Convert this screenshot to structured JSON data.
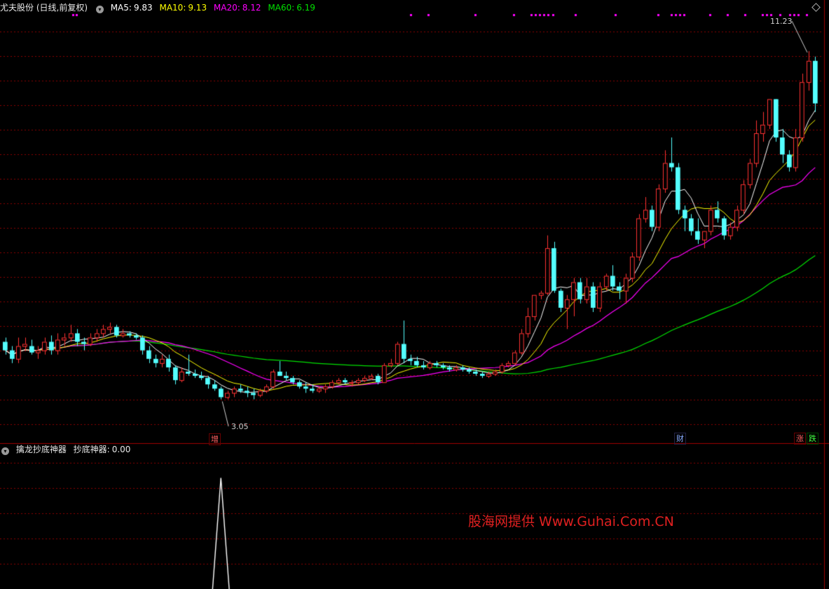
{
  "header": {
    "stock_name": "尤夫股份",
    "mode": "(日线,前复权)",
    "ma5": {
      "label": "MA5:",
      "value": "9.83",
      "color": "#ffffff"
    },
    "ma10": {
      "label": "MA10:",
      "value": "9.13",
      "color": "#ffff00"
    },
    "ma20": {
      "label": "MA20:",
      "value": "8.12",
      "color": "#ff00ff"
    },
    "ma60": {
      "label": "MA60:",
      "value": "6.19",
      "color": "#00e000"
    }
  },
  "indicator": {
    "name": "擒龙抄底神器",
    "series_label": "抄底神器:",
    "value": "0.00"
  },
  "markers": {
    "zeng": "增",
    "cai": "财",
    "zhang": "涨",
    "die": "跌"
  },
  "annotations": {
    "high_label": "11.23",
    "low_label": "3.05"
  },
  "watermark": "股海网提供 Www.Guhai.Com.CN",
  "colors": {
    "up": "#ff3232",
    "down": "#54ffff",
    "ma5": "#ffffff",
    "ma10": "#ffff00",
    "ma20": "#ff00ff",
    "ma60": "#00e000",
    "grid": "#8b0000",
    "signal_dots": "#ff00ff"
  },
  "chart_data": {
    "type": "candlestick",
    "ylim": [
      2.3,
      12.1
    ],
    "indicator_ylim": [
      0,
      1.2
    ],
    "candles": [
      [
        4.4,
        4.5,
        4.1,
        4.2
      ],
      [
        4.2,
        4.3,
        3.9,
        4.0
      ],
      [
        4.0,
        4.5,
        3.9,
        4.3
      ],
      [
        4.3,
        4.5,
        4.2,
        4.35
      ],
      [
        4.3,
        4.45,
        4.1,
        4.15
      ],
      [
        4.15,
        4.3,
        4.0,
        4.2
      ],
      [
        4.2,
        4.5,
        4.1,
        4.4
      ],
      [
        4.4,
        4.55,
        4.1,
        4.2
      ],
      [
        4.2,
        4.6,
        4.1,
        4.45
      ],
      [
        4.45,
        4.6,
        4.3,
        4.5
      ],
      [
        4.5,
        4.8,
        4.4,
        4.6
      ],
      [
        4.6,
        4.7,
        4.3,
        4.4
      ],
      [
        4.4,
        4.5,
        4.2,
        4.35
      ],
      [
        4.35,
        4.6,
        4.3,
        4.5
      ],
      [
        4.5,
        4.7,
        4.4,
        4.6
      ],
      [
        4.6,
        4.8,
        4.5,
        4.7
      ],
      [
        4.7,
        4.85,
        4.6,
        4.75
      ],
      [
        4.75,
        4.8,
        4.5,
        4.55
      ],
      [
        4.55,
        4.7,
        4.5,
        4.6
      ],
      [
        4.6,
        4.65,
        4.5,
        4.55
      ],
      [
        4.55,
        4.6,
        4.45,
        4.5
      ],
      [
        4.5,
        4.55,
        4.1,
        4.2
      ],
      [
        4.2,
        4.3,
        3.9,
        4.0
      ],
      [
        4.0,
        4.1,
        3.8,
        3.9
      ],
      [
        3.9,
        4.1,
        3.8,
        4.0
      ],
      [
        4.0,
        4.1,
        3.7,
        3.8
      ],
      [
        3.8,
        3.85,
        3.4,
        3.5
      ],
      [
        3.5,
        3.8,
        3.45,
        3.7
      ],
      [
        3.7,
        4.1,
        3.6,
        3.65
      ],
      [
        3.65,
        3.75,
        3.55,
        3.6
      ],
      [
        3.6,
        3.7,
        3.5,
        3.55
      ],
      [
        3.55,
        3.6,
        3.3,
        3.4
      ],
      [
        3.4,
        3.5,
        3.25,
        3.3
      ],
      [
        3.3,
        3.35,
        3.05,
        3.1
      ],
      [
        3.1,
        3.25,
        3.05,
        3.2
      ],
      [
        3.2,
        3.35,
        3.1,
        3.3
      ],
      [
        3.3,
        3.4,
        3.2,
        3.25
      ],
      [
        3.25,
        3.35,
        3.1,
        3.2
      ],
      [
        3.2,
        3.3,
        3.05,
        3.15
      ],
      [
        3.15,
        3.3,
        3.1,
        3.25
      ],
      [
        3.25,
        3.4,
        3.2,
        3.35
      ],
      [
        3.35,
        3.75,
        3.3,
        3.7
      ],
      [
        3.7,
        3.95,
        3.6,
        3.6
      ],
      [
        3.6,
        3.7,
        3.5,
        3.55
      ],
      [
        3.55,
        3.6,
        3.4,
        3.45
      ],
      [
        3.45,
        3.5,
        3.3,
        3.35
      ],
      [
        3.35,
        3.45,
        3.2,
        3.3
      ],
      [
        3.3,
        3.4,
        3.2,
        3.25
      ],
      [
        3.25,
        3.35,
        3.2,
        3.3
      ],
      [
        3.3,
        3.4,
        3.2,
        3.35
      ],
      [
        3.35,
        3.5,
        3.3,
        3.45
      ],
      [
        3.45,
        3.55,
        3.4,
        3.5
      ],
      [
        3.5,
        3.55,
        3.4,
        3.45
      ],
      [
        3.45,
        3.5,
        3.35,
        3.45
      ],
      [
        3.45,
        3.55,
        3.4,
        3.5
      ],
      [
        3.5,
        3.6,
        3.45,
        3.55
      ],
      [
        3.55,
        3.65,
        3.5,
        3.6
      ],
      [
        3.6,
        3.65,
        3.4,
        3.45
      ],
      [
        3.45,
        3.9,
        3.45,
        3.85
      ],
      [
        3.85,
        4.0,
        3.8,
        3.9
      ],
      [
        3.9,
        4.4,
        3.85,
        4.35
      ],
      [
        4.35,
        4.9,
        3.9,
        4.0
      ],
      [
        4.0,
        4.1,
        3.85,
        3.95
      ],
      [
        3.95,
        4.05,
        3.8,
        3.85
      ],
      [
        3.85,
        3.95,
        3.75,
        3.8
      ],
      [
        3.8,
        3.95,
        3.75,
        3.9
      ],
      [
        3.9,
        3.95,
        3.8,
        3.85
      ],
      [
        3.85,
        3.9,
        3.75,
        3.8
      ],
      [
        3.8,
        3.85,
        3.7,
        3.75
      ],
      [
        3.75,
        3.85,
        3.7,
        3.8
      ],
      [
        3.8,
        3.85,
        3.7,
        3.75
      ],
      [
        3.75,
        3.8,
        3.65,
        3.7
      ],
      [
        3.7,
        3.75,
        3.6,
        3.65
      ],
      [
        3.65,
        3.7,
        3.55,
        3.6
      ],
      [
        3.6,
        3.7,
        3.55,
        3.65
      ],
      [
        3.65,
        3.75,
        3.6,
        3.7
      ],
      [
        3.7,
        3.9,
        3.65,
        3.85
      ],
      [
        3.85,
        3.95,
        3.8,
        3.9
      ],
      [
        3.9,
        4.2,
        3.85,
        4.15
      ],
      [
        4.15,
        4.7,
        4.1,
        4.6
      ],
      [
        4.6,
        5.2,
        4.5,
        5.0
      ],
      [
        5.0,
        5.5,
        4.9,
        5.5
      ],
      [
        5.5,
        5.6,
        5.4,
        5.55
      ],
      [
        5.55,
        6.9,
        5.5,
        6.6
      ],
      [
        6.6,
        6.75,
        5.55,
        5.6
      ],
      [
        5.6,
        5.65,
        5.1,
        5.2
      ],
      [
        5.2,
        5.5,
        4.7,
        5.4
      ],
      [
        5.4,
        5.9,
        5.0,
        5.8
      ],
      [
        5.8,
        5.9,
        5.3,
        5.4
      ],
      [
        5.4,
        5.9,
        5.3,
        5.7
      ],
      [
        5.7,
        5.8,
        5.1,
        5.2
      ],
      [
        5.2,
        5.8,
        5.1,
        5.7
      ],
      [
        5.7,
        6.0,
        5.6,
        5.95
      ],
      [
        5.95,
        6.2,
        5.6,
        5.7
      ],
      [
        5.7,
        5.8,
        5.4,
        5.6
      ],
      [
        5.6,
        6.0,
        5.3,
        5.9
      ],
      [
        5.9,
        6.5,
        5.8,
        6.4
      ],
      [
        6.4,
        7.4,
        6.3,
        7.3
      ],
      [
        7.3,
        7.8,
        7.2,
        7.5
      ],
      [
        7.5,
        7.6,
        7.0,
        7.1
      ],
      [
        7.1,
        8.1,
        7.0,
        8.0
      ],
      [
        8.0,
        8.9,
        7.9,
        8.6
      ],
      [
        8.6,
        9.2,
        8.4,
        8.5
      ],
      [
        8.5,
        8.6,
        7.4,
        7.5
      ],
      [
        7.5,
        7.6,
        7.0,
        7.3
      ],
      [
        7.3,
        7.4,
        6.9,
        7.0
      ],
      [
        7.0,
        7.3,
        6.7,
        6.8
      ],
      [
        6.8,
        7.0,
        6.6,
        7.0
      ],
      [
        7.0,
        7.6,
        6.9,
        7.5
      ],
      [
        7.5,
        7.7,
        7.2,
        7.3
      ],
      [
        7.3,
        7.35,
        6.8,
        6.9
      ],
      [
        6.9,
        7.2,
        6.8,
        7.1
      ],
      [
        7.1,
        7.6,
        7.0,
        7.5
      ],
      [
        7.5,
        8.2,
        7.4,
        8.1
      ],
      [
        8.1,
        8.7,
        8.0,
        8.6
      ],
      [
        8.6,
        9.6,
        8.5,
        9.3
      ],
      [
        9.3,
        9.8,
        9.1,
        9.5
      ],
      [
        9.5,
        10.1,
        9.4,
        10.1
      ],
      [
        10.1,
        10.1,
        9.1,
        9.2
      ],
      [
        9.2,
        9.4,
        8.6,
        8.8
      ],
      [
        8.8,
        8.9,
        8.4,
        8.5
      ],
      [
        8.5,
        9.4,
        8.4,
        9.2
      ],
      [
        9.2,
        10.7,
        9.1,
        10.5
      ],
      [
        10.5,
        11.23,
        10.3,
        11.0
      ],
      [
        11.0,
        11.1,
        9.8,
        10.0
      ]
    ],
    "signal_bar_index": 33
  }
}
